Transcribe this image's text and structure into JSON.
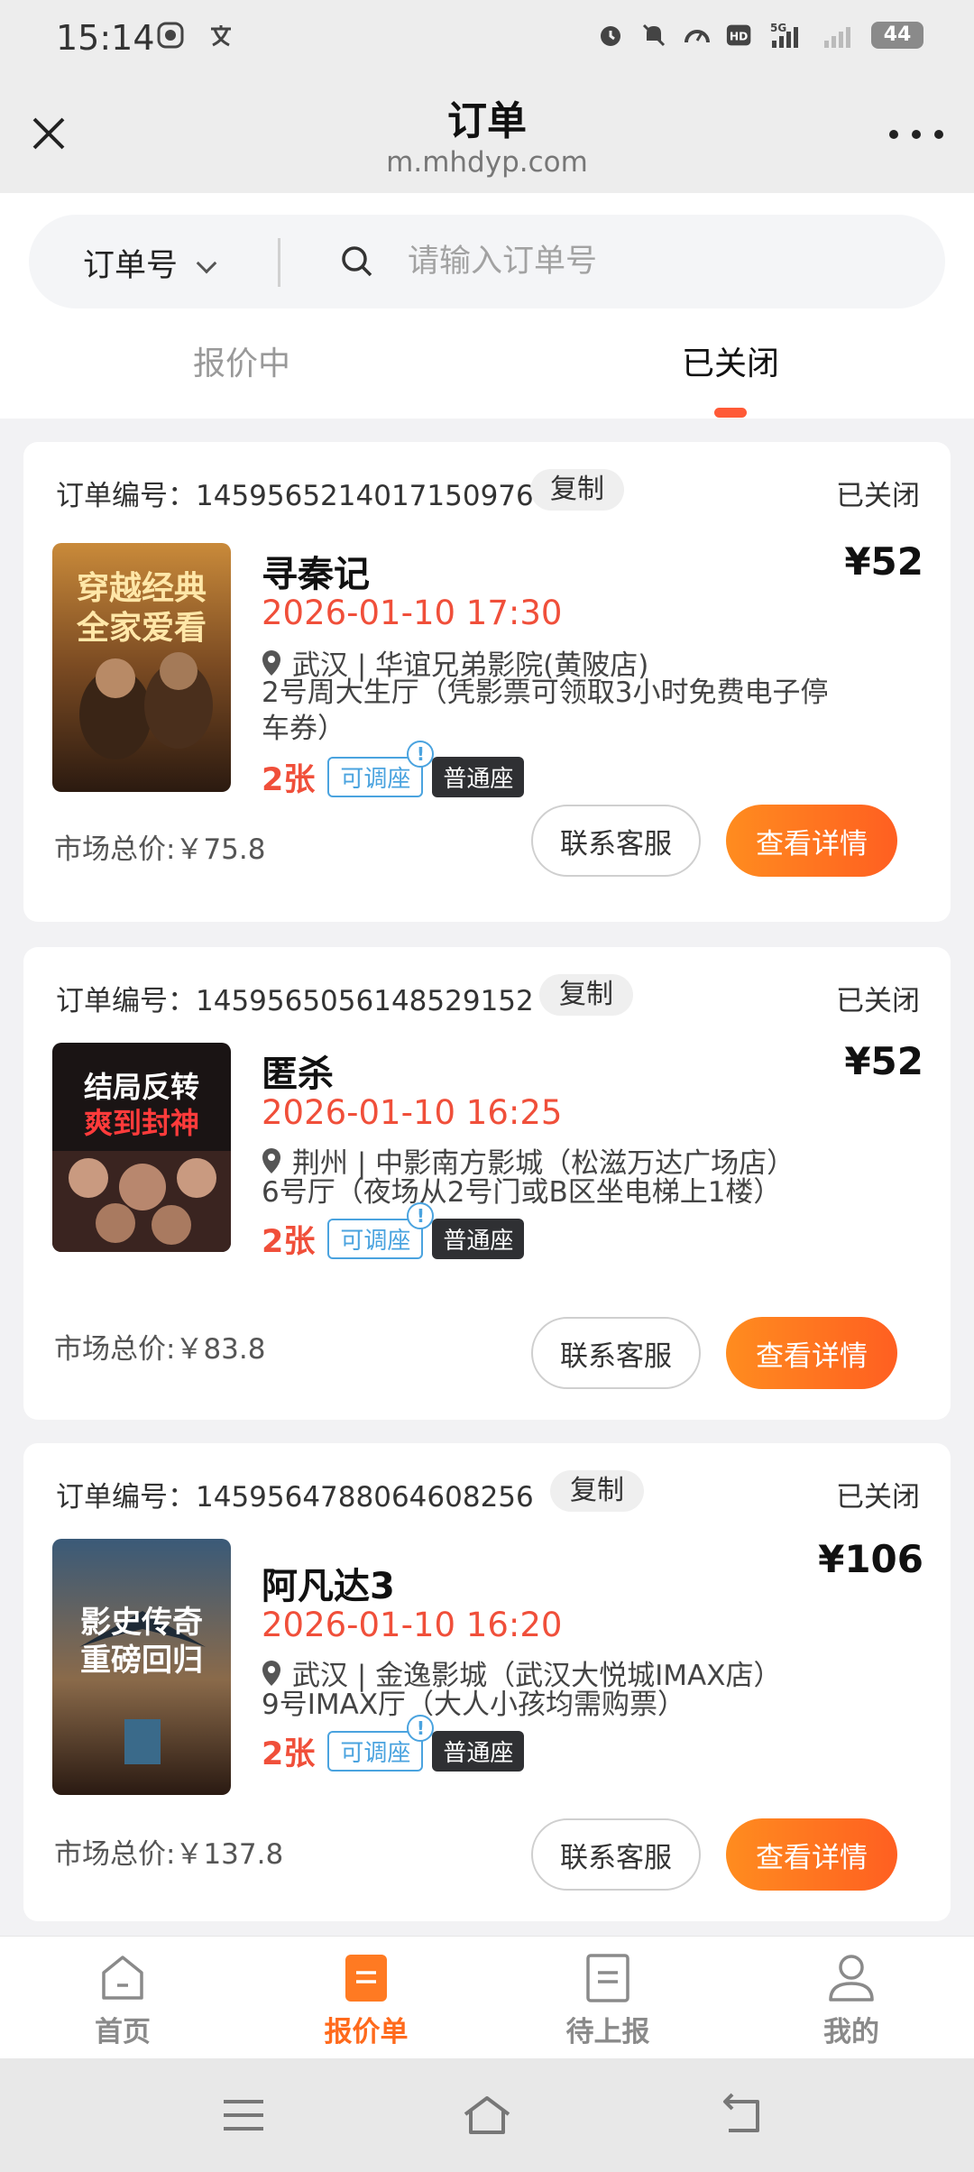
{
  "status_bar": {
    "time": "15:14",
    "network": "5G",
    "battery": "44"
  },
  "header": {
    "title": "订单",
    "subtitle": "m.mhdyp.com"
  },
  "search": {
    "type_label": "订单号",
    "placeholder": "请输入订单号"
  },
  "tabs": [
    {
      "label": "报价中",
      "active": false
    },
    {
      "label": "已关闭",
      "active": true
    }
  ],
  "orders": [
    {
      "order_label": "订单编号：1459565214017150976",
      "copy_label": "复制",
      "status": "已关闭",
      "poster_text": [
        "穿越经典",
        "全家爱看"
      ],
      "title": "寻秦记",
      "price": "¥52",
      "showtime": "2026-01-10 17:30",
      "location": "武汉 | 华谊兄弟影院(黄陂店)",
      "hall_line1": "2号周大生厅（凭影票可领取3小时免费电子停",
      "hall_line2": "车券）",
      "tickets": "2张",
      "tag_adjust": "可调座",
      "tag_seat": "普通座",
      "market_price": "市场总价:￥75.8",
      "service_label": "联系客服",
      "detail_label": "查看详情"
    },
    {
      "order_label": "订单编号：1459565056148529152",
      "copy_label": "复制",
      "status": "已关闭",
      "poster_text": [
        "结局反转",
        "爽到封神"
      ],
      "title": "匿杀",
      "price": "¥52",
      "showtime": "2026-01-10 16:25",
      "location": "荆州 | 中影南方影城（松滋万达广场店）",
      "hall_line1": "6号厅（夜场从2号门或B区坐电梯上1楼）",
      "tickets": "2张",
      "tag_adjust": "可调座",
      "tag_seat": "普通座",
      "market_price": "市场总价:￥83.8",
      "service_label": "联系客服",
      "detail_label": "查看详情"
    },
    {
      "order_label": "订单编号：1459564788064608256",
      "copy_label": "复制",
      "status": "已关闭",
      "poster_text": [
        "影史传奇",
        "重磅回归"
      ],
      "title": "阿凡达3",
      "price": "¥106",
      "showtime": "2026-01-10 16:20",
      "location": "武汉 | 金逸影城（武汉大悦城IMAX店）",
      "hall_line1": "9号IMAX厅（大人小孩均需购票）",
      "tickets": "2张",
      "tag_adjust": "可调座",
      "tag_seat": "普通座",
      "market_price": "市场总价:￥137.8",
      "service_label": "联系客服",
      "detail_label": "查看详情"
    }
  ],
  "bottom_tabs": [
    {
      "label": "首页",
      "icon": "home-icon",
      "active": false
    },
    {
      "label": "报价单",
      "icon": "quote-icon",
      "active": true
    },
    {
      "label": "待上报",
      "icon": "report-icon",
      "active": false
    },
    {
      "label": "我的",
      "icon": "user-icon",
      "active": false
    }
  ],
  "colors": {
    "accent": "#ff5f21",
    "price_red": "#f04f3a",
    "tag_blue": "#4aa3df"
  }
}
